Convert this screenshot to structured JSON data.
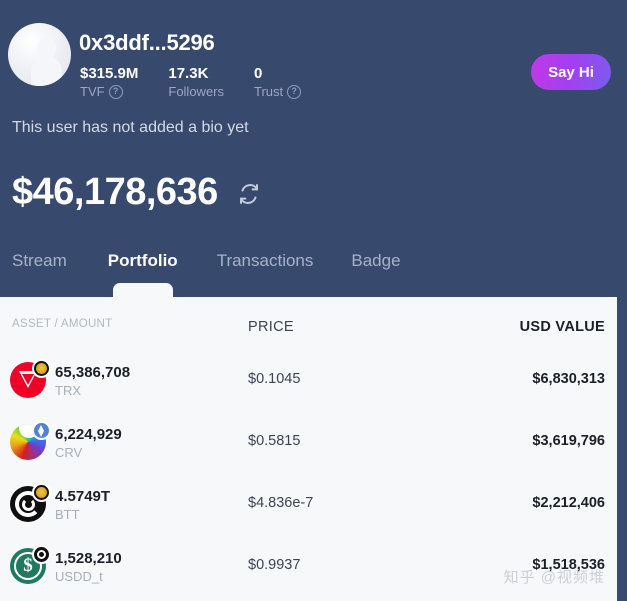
{
  "profile": {
    "avatar_icon": "default-user-avatar",
    "name": "0x3ddf...5296",
    "say_hi_label": "Say Hi",
    "bio": "This user has not added a bio yet",
    "balance": "$46,178,636",
    "refresh_icon": "refresh-icon",
    "stats": [
      {
        "value": "$315.9M",
        "label": "TVF",
        "has_help": true
      },
      {
        "value": "17.3K",
        "label": "Followers",
        "has_help": false
      },
      {
        "value": "0",
        "label": "Trust",
        "has_help": true
      }
    ]
  },
  "tabs": [
    {
      "label": "Stream",
      "active": false
    },
    {
      "label": "Portfolio",
      "active": true
    },
    {
      "label": "Transactions",
      "active": false
    },
    {
      "label": "Badge",
      "active": false
    }
  ],
  "portfolio": {
    "columns": {
      "asset": "ASSET / AMOUNT",
      "price": "PRICE",
      "usd": "USD VALUE"
    },
    "rows": [
      {
        "icon": "trx-coin-icon",
        "badge": "tron-chain-badge",
        "amount": "65,386,708",
        "symbol": "TRX",
        "price": "$0.1045",
        "usd_value": "$6,830,313"
      },
      {
        "icon": "crv-coin-icon",
        "badge": "ethereum-chain-badge",
        "amount": "6,224,929",
        "symbol": "CRV",
        "price": "$0.5815",
        "usd_value": "$3,619,796"
      },
      {
        "icon": "btt-coin-icon",
        "badge": "tron-chain-badge",
        "amount": "4.5749T",
        "symbol": "BTT",
        "price": "$4.836e-7",
        "usd_value": "$2,212,406"
      },
      {
        "icon": "usdd-coin-icon",
        "badge": "dark-chain-badge",
        "amount": "1,528,210",
        "symbol": "USDD_t",
        "price": "$0.9937",
        "usd_value": "$1,518,536"
      }
    ]
  },
  "watermark": "知乎 @视频堆",
  "colors": {
    "header_bg": "#374a6e",
    "panel_bg": "#f7f8fa",
    "accent_button": "#a43ef0",
    "muted_text": "#9aa7c2"
  }
}
